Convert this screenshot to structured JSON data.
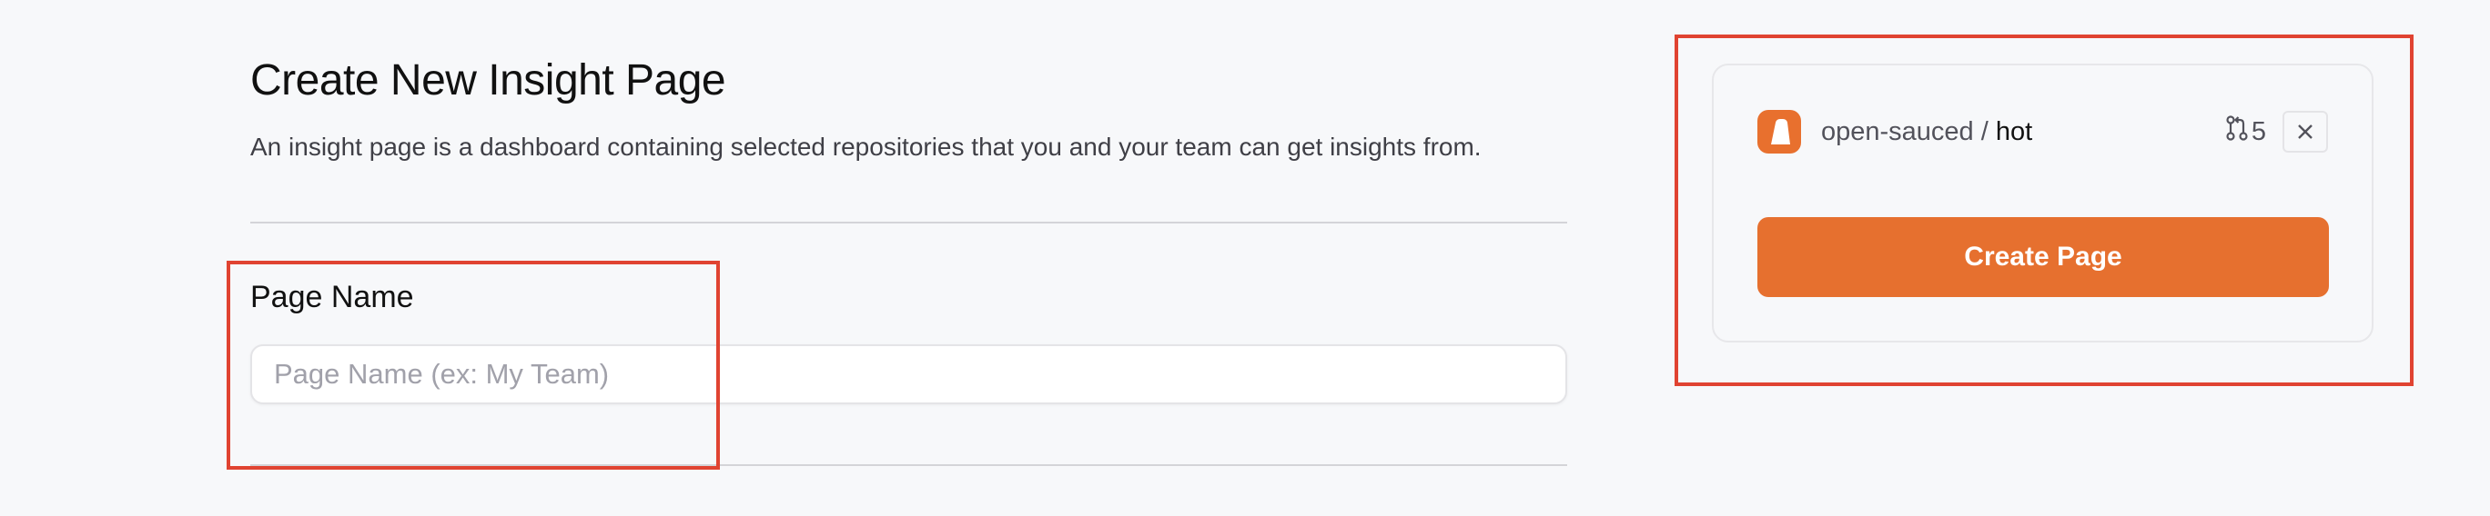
{
  "page": {
    "title": "Create New Insight Page",
    "description": "An insight page is a dashboard containing selected repositories that you and your team can get insights from."
  },
  "form": {
    "page_name_label": "Page Name",
    "page_name_placeholder": "Page Name (ex: My Team)",
    "page_name_value": ""
  },
  "sidebar": {
    "repo": {
      "owner": "open-sauced",
      "separator": " / ",
      "name": "hot",
      "pr_count": "5",
      "avatar_icon": "open-sauced-logo-icon",
      "pr_icon": "git-pull-request-icon",
      "remove_icon": "close-icon"
    },
    "create_button_label": "Create Page"
  },
  "colors": {
    "accent": "#e6702f",
    "highlight": "#e04331",
    "background": "#f7f8fa"
  }
}
